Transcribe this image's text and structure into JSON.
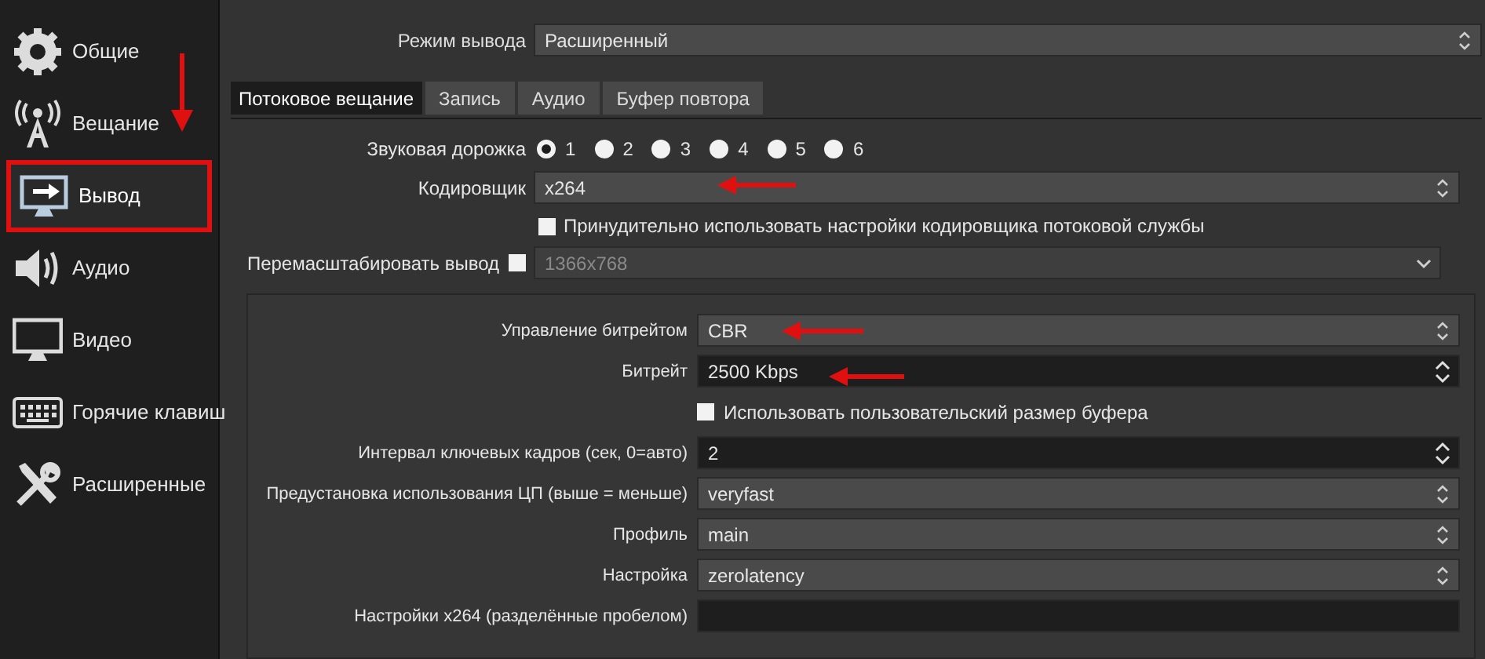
{
  "sidebar": {
    "items": [
      {
        "label": "Общие",
        "selected": false
      },
      {
        "label": "Вещание",
        "selected": false
      },
      {
        "label": "Вывод",
        "selected": true
      },
      {
        "label": "Аудио",
        "selected": false
      },
      {
        "label": "Видео",
        "selected": false
      },
      {
        "label": "Горячие клавиш",
        "selected": false
      },
      {
        "label": "Расширенные",
        "selected": false
      }
    ]
  },
  "output_mode": {
    "label": "Режим вывода",
    "value": "Расширенный"
  },
  "tabs": [
    {
      "label": "Потоковое вещание",
      "selected": true
    },
    {
      "label": "Запись",
      "selected": false
    },
    {
      "label": "Аудио",
      "selected": false
    },
    {
      "label": "Буфер повтора",
      "selected": false
    }
  ],
  "audio_track": {
    "label": "Звуковая дорожка",
    "options": [
      {
        "label": "1",
        "selected": true
      },
      {
        "label": "2",
        "selected": false
      },
      {
        "label": "3",
        "selected": false
      },
      {
        "label": "4",
        "selected": false
      },
      {
        "label": "5",
        "selected": false
      },
      {
        "label": "6",
        "selected": false
      }
    ]
  },
  "encoder": {
    "label": "Кодировщик",
    "value": "x264"
  },
  "force_encoder_settings": {
    "label": "Принудительно использовать настройки кодировщика потоковой службы",
    "checked": false
  },
  "rescale": {
    "label": "Перемасштабировать вывод",
    "checked": false,
    "value": "1366x768",
    "disabled": true
  },
  "encoder_settings": [
    {
      "kind": "combo",
      "label": "Управление битрейтом",
      "value": "CBR"
    },
    {
      "kind": "spin",
      "label": "Битрейт",
      "value": "2500 Kbps"
    },
    {
      "kind": "checkbox",
      "label": "Использовать пользовательский размер буфера",
      "checked": false
    },
    {
      "kind": "spin",
      "label": "Интервал ключевых кадров (сек, 0=авто)",
      "value": "2"
    },
    {
      "kind": "combo",
      "label": "Предустановка использования ЦП (выше = меньше)",
      "value": "veryfast"
    },
    {
      "kind": "combo",
      "label": "Профиль",
      "value": "main"
    },
    {
      "kind": "combo",
      "label": "Настройка",
      "value": "zerolatency"
    },
    {
      "kind": "text",
      "label": "Настройки x264 (разделённые пробелом)"
    }
  ]
}
